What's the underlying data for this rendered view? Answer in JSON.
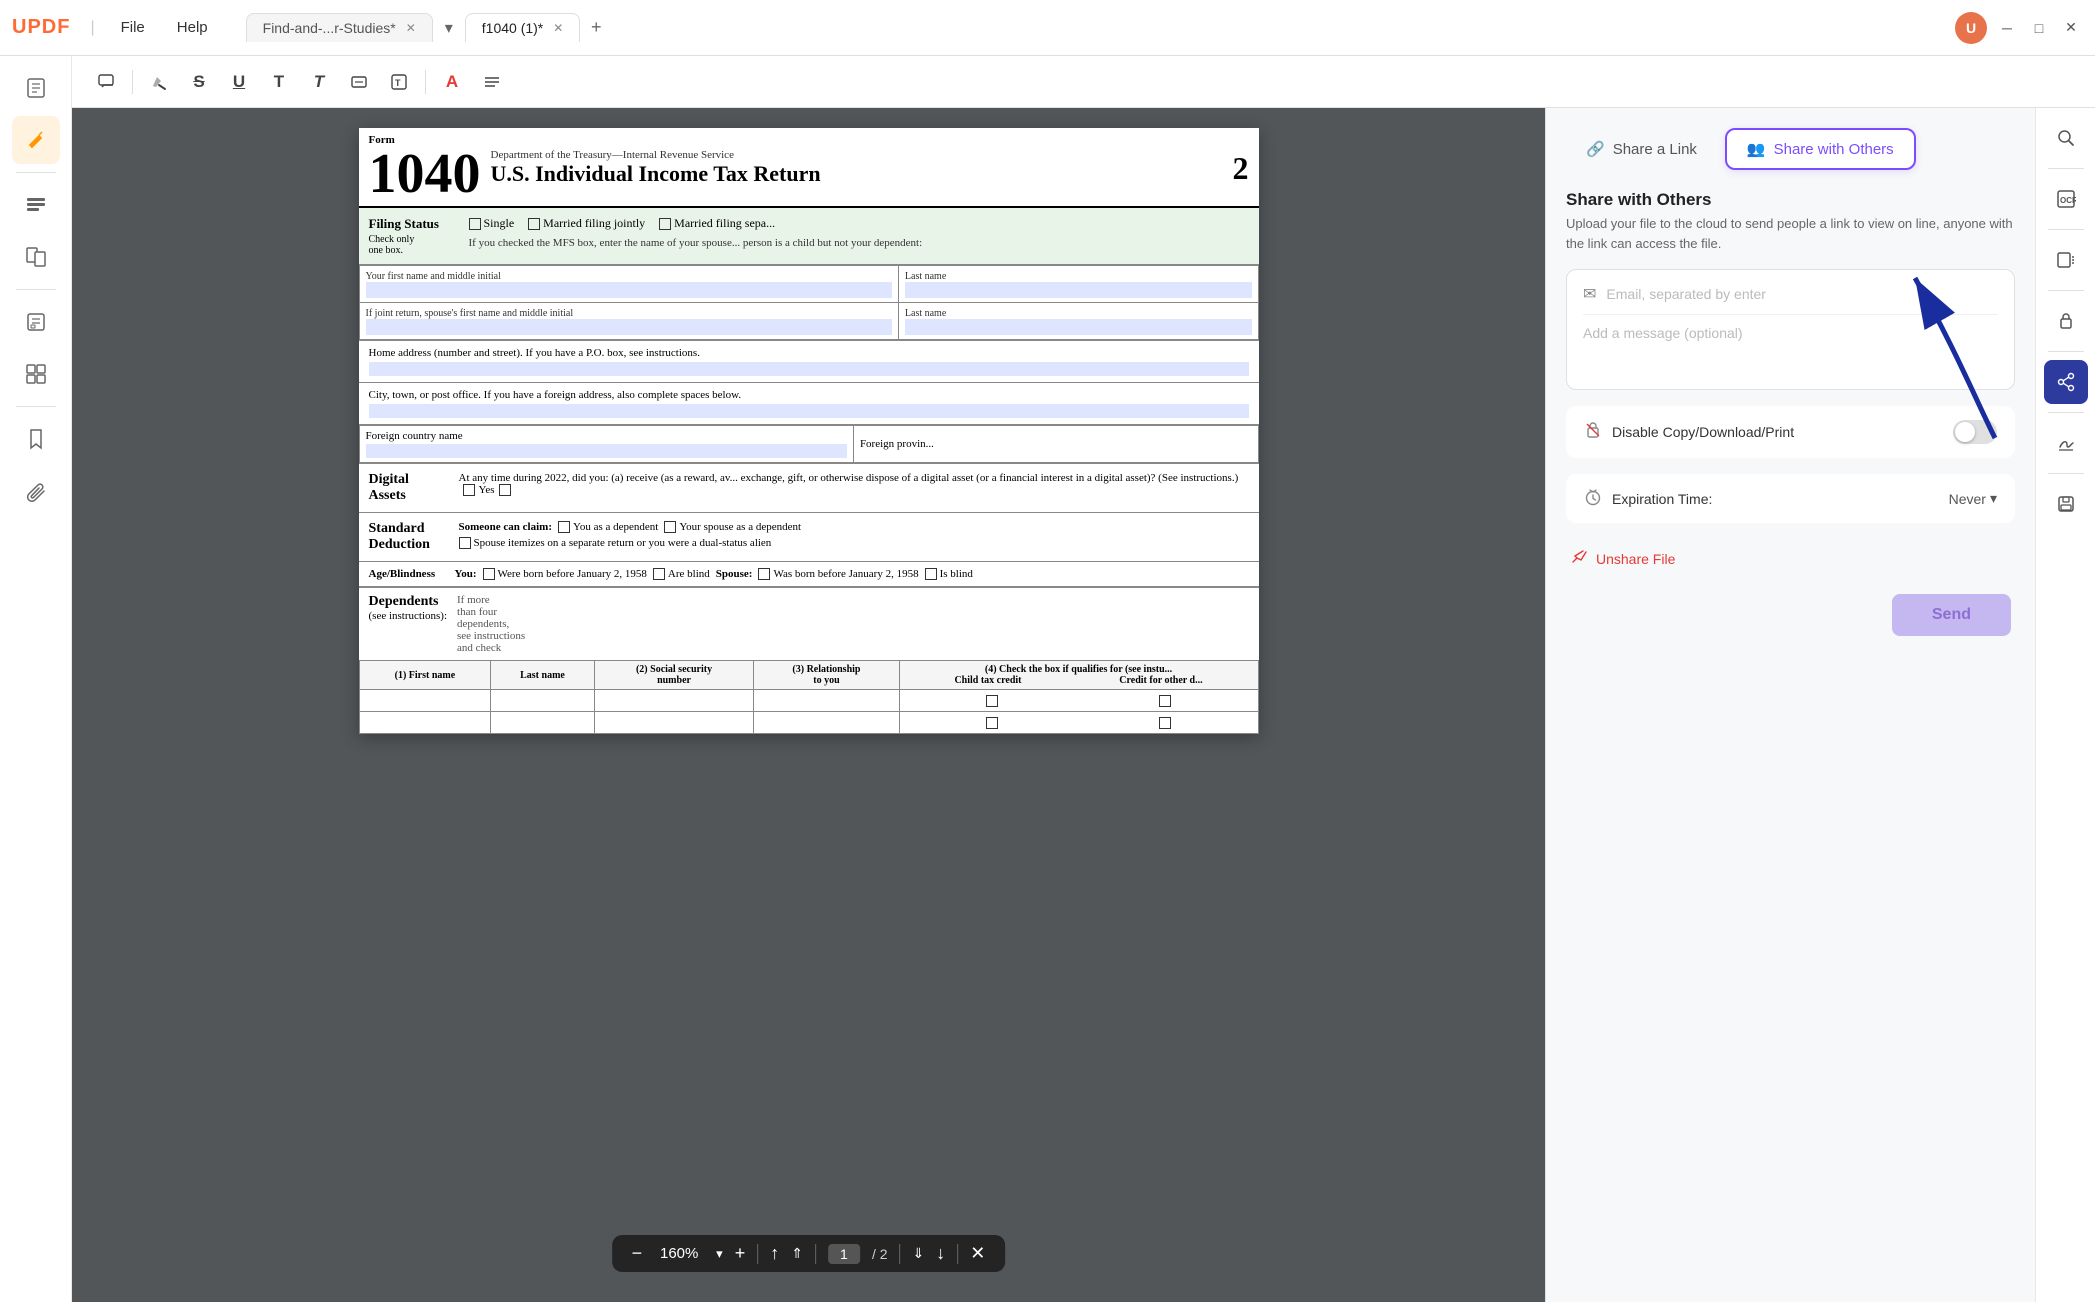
{
  "app": {
    "logo": "UPDF",
    "menus": [
      "File",
      "Help"
    ],
    "tabs": [
      {
        "label": "Find-and-...r-Studies*",
        "active": false
      },
      {
        "label": "f1040 (1)*",
        "active": true
      }
    ]
  },
  "toolbar": {
    "tools": [
      "comment",
      "highlight",
      "strikethrough",
      "underline",
      "text",
      "text-bold",
      "text-box",
      "text-style",
      "color",
      "more"
    ]
  },
  "share_panel": {
    "tab_share_link": "Share a Link",
    "tab_share_others": "Share with Others",
    "title": "Share with Others",
    "description": "Upload your file to the cloud to send people a link to view on line, anyone with the link can access the file.",
    "email_placeholder": "Email, separated by enter",
    "message_placeholder": "Add a message (optional)",
    "disable_label": "Disable Copy/Download/Print",
    "expiration_label": "Expiration Time:",
    "expiration_value": "Never",
    "unshare_label": "Unshare File",
    "send_btn": "Send"
  },
  "pdf_viewer": {
    "zoom": "160%",
    "current_page": "1",
    "total_pages": "2"
  },
  "sidebar": {
    "icons": [
      "document",
      "pen",
      "list",
      "bookmark",
      "pages",
      "layers",
      "bookmark2",
      "paperclip"
    ]
  },
  "right_sidebar": {
    "icons": [
      "search",
      "ocr",
      "convert",
      "protect",
      "share",
      "sign",
      "save"
    ]
  }
}
